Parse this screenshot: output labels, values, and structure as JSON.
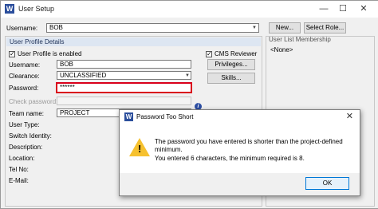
{
  "window": {
    "title": "User Setup",
    "app_icon_letter": "W",
    "minimize": "—",
    "maximize": "☐",
    "close": "✕"
  },
  "top": {
    "username_label": "Username:",
    "username_value": "BOB",
    "new_button": "New...",
    "select_role_button": "Select Role..."
  },
  "profile": {
    "group_title": "User Profile Details",
    "enabled_label": "User Profile is enabled",
    "username_label": "Username:",
    "username_value": "BOB",
    "clearance_label": "Clearance:",
    "clearance_value": "UNCLASSIFIED",
    "password_label": "Password:",
    "password_value": "******",
    "check_password_label": "Check password:",
    "team_name_label": "Team name:",
    "team_name_value": "PROJECT",
    "user_type_label": "User Type:",
    "switch_identity_label": "Switch Identity:",
    "description_label": "Description:",
    "location_label": "Location:",
    "tel_no_label": "Tel No:",
    "email_label": "E-Mail:",
    "cms_reviewer_label": "CMS Reviewer",
    "privileges_button": "Privileges...",
    "skills_button": "Skills...",
    "info_icon": "i"
  },
  "membership": {
    "title": "User List Membership",
    "value": "<None>"
  },
  "dialog": {
    "icon_letter": "W",
    "title": "Password Too Short",
    "close": "✕",
    "warning_mark": "!",
    "line1": "The password you have entered is shorter than the project-defined",
    "line2": "minimum.",
    "line3": "You entered 6 characters, the minimum required is 8.",
    "ok_button": "OK"
  },
  "colors": {
    "password_error_border": "#d9001b",
    "warning_icon": "#f6c12f",
    "ok_focus_border": "#0078d7"
  }
}
